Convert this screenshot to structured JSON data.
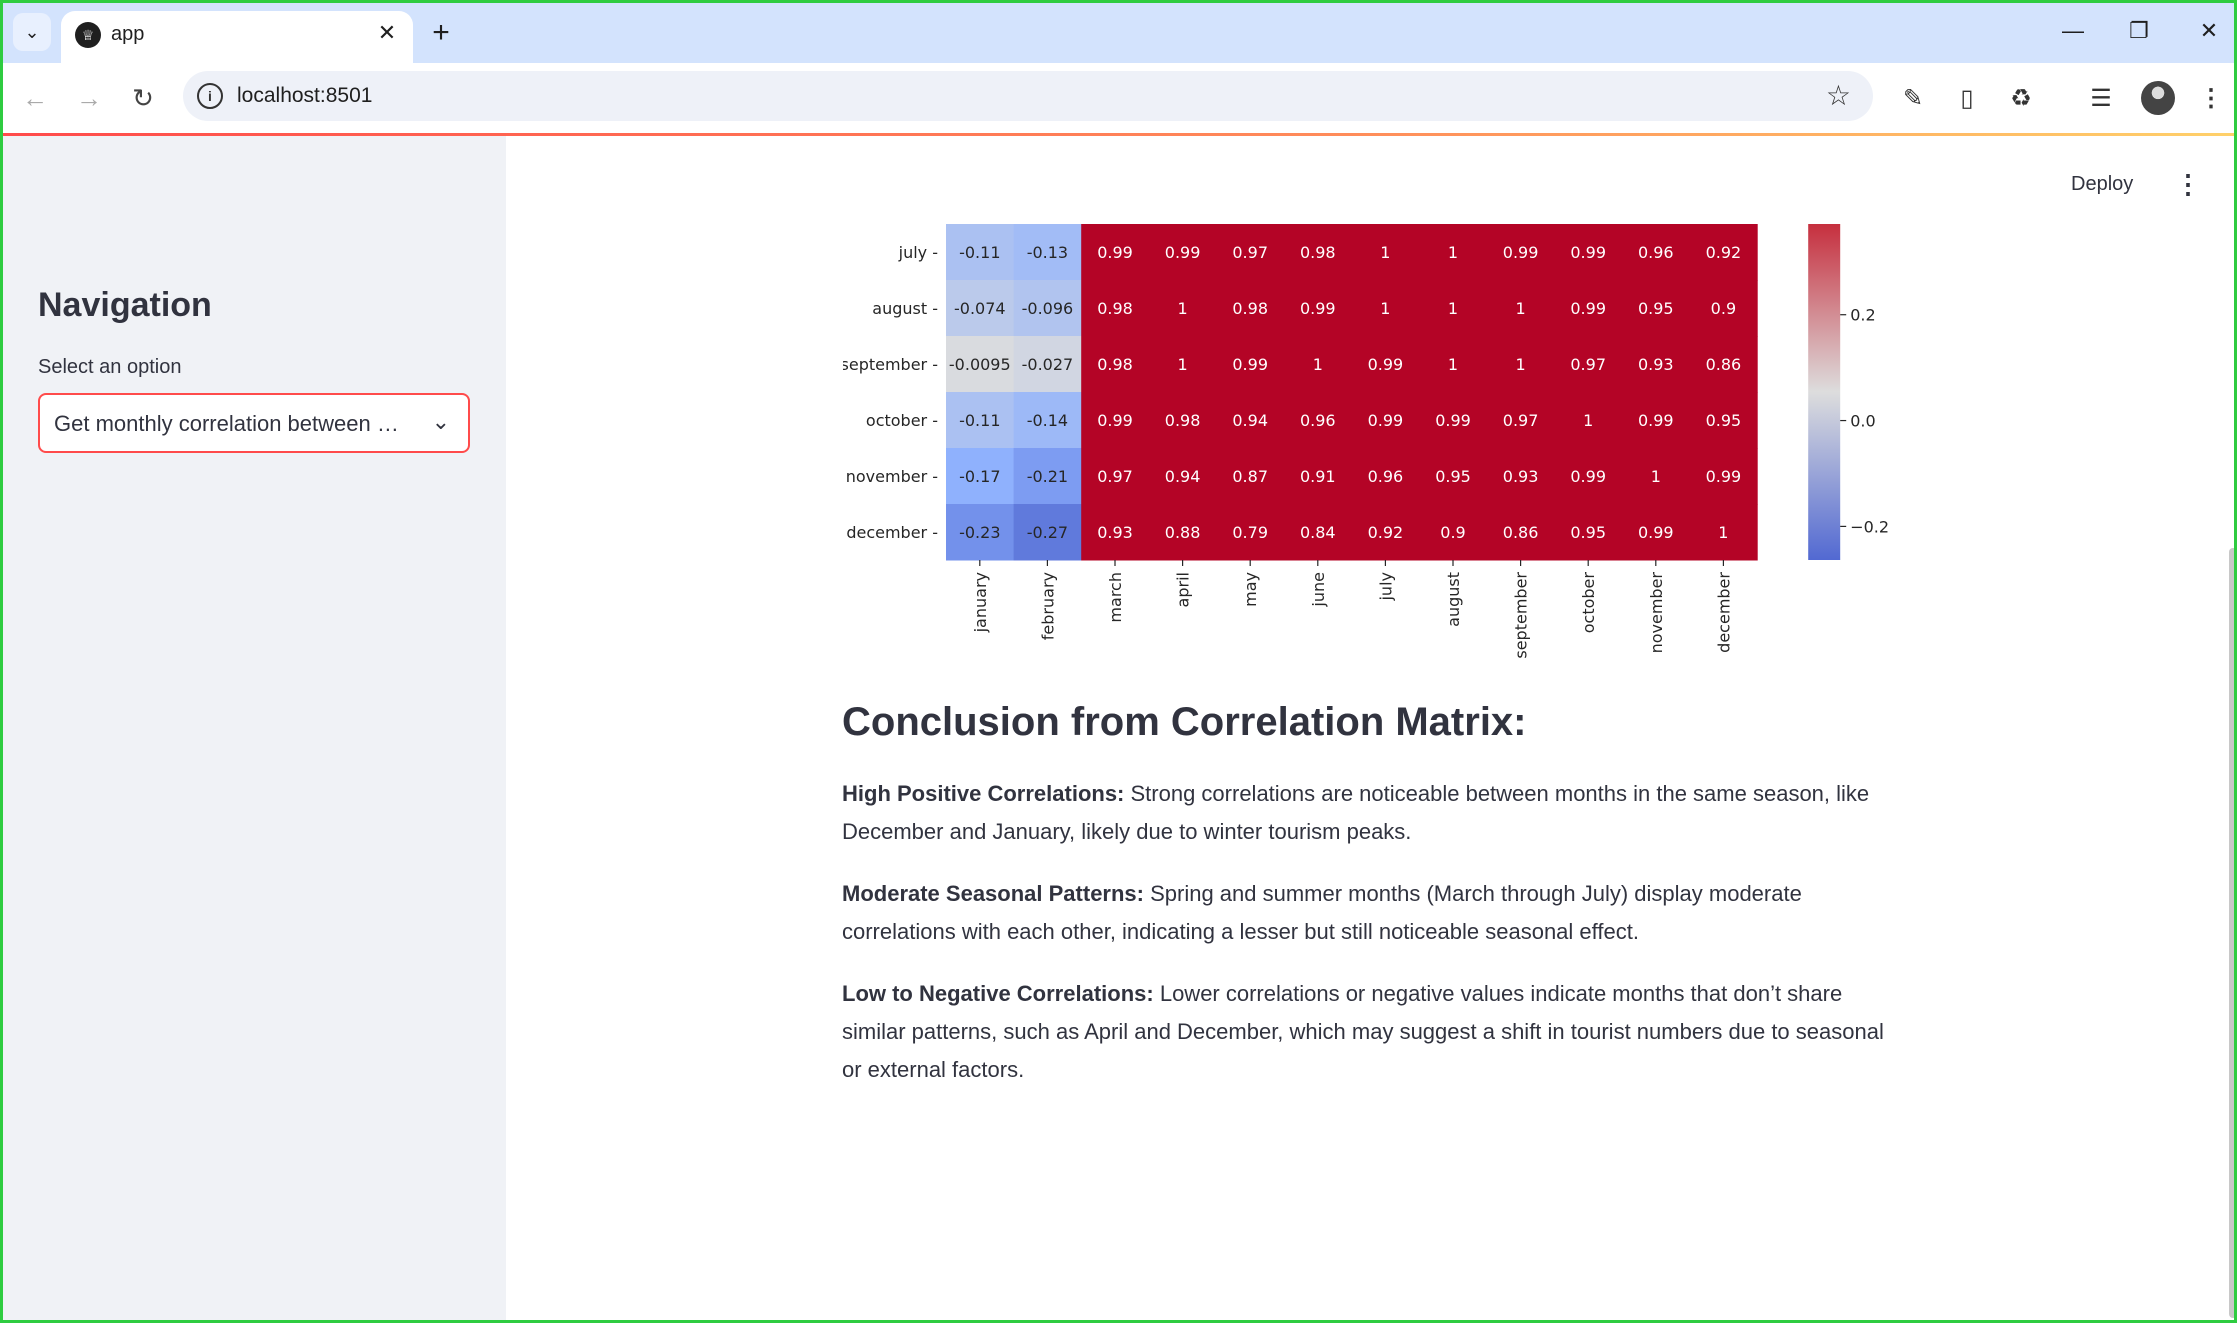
{
  "browser": {
    "tab_title": "app",
    "url": "localhost:8501"
  },
  "sidebar": {
    "title": "Navigation",
    "select_label": "Select an option",
    "select_value": "Get monthly correlation between months"
  },
  "header": {
    "deploy_label": "Deploy"
  },
  "chart_data": {
    "type": "heatmap",
    "x_labels": [
      "january",
      "february",
      "march",
      "april",
      "may",
      "june",
      "july",
      "august",
      "september",
      "october",
      "november",
      "december"
    ],
    "y_labels": [
      "july",
      "august",
      "september",
      "october",
      "november",
      "december"
    ],
    "cells": [
      [
        "-0.11",
        "-0.13",
        "0.99",
        "0.99",
        "0.97",
        "0.98",
        "1",
        "1",
        "0.99",
        "0.99",
        "0.96",
        "0.92"
      ],
      [
        "-0.074",
        "-0.096",
        "0.98",
        "1",
        "0.98",
        "0.99",
        "1",
        "1",
        "1",
        "0.99",
        "0.95",
        "0.9"
      ],
      [
        "-0.0095",
        "-0.027",
        "0.98",
        "1",
        "0.99",
        "1",
        "0.99",
        "1",
        "1",
        "0.97",
        "0.93",
        "0.86"
      ],
      [
        "-0.11",
        "-0.14",
        "0.99",
        "0.98",
        "0.94",
        "0.96",
        "0.99",
        "0.99",
        "0.97",
        "1",
        "0.99",
        "0.95"
      ],
      [
        "-0.17",
        "-0.21",
        "0.97",
        "0.94",
        "0.87",
        "0.91",
        "0.96",
        "0.95",
        "0.93",
        "0.99",
        "1",
        "0.99"
      ],
      [
        "-0.23",
        "-0.27",
        "0.93",
        "0.88",
        "0.79",
        "0.84",
        "0.92",
        "0.9",
        "0.86",
        "0.95",
        "0.99",
        "1"
      ]
    ],
    "colorbar_ticks": [
      "0.2",
      "0.0",
      "−0.2"
    ],
    "colormap": "coolwarm"
  },
  "conclusion": {
    "title": "Conclusion from Correlation Matrix:",
    "p1_bold": "High Positive Correlations:",
    "p1_text": " Strong correlations are noticeable between months in the same season, like December and January, likely due to winter tourism peaks.",
    "p2_bold": "Moderate Seasonal Patterns:",
    "p2_text": " Spring and summer months (March through July) display moderate correlations with each other, indicating a lesser but still noticeable seasonal effect.",
    "p3_bold": "Low to Negative Correlations:",
    "p3_text": " Lower correlations or negative values indicate months that don’t share similar patterns, such as April and December, which may suggest a shift in tourist numbers due to seasonal or external factors."
  }
}
